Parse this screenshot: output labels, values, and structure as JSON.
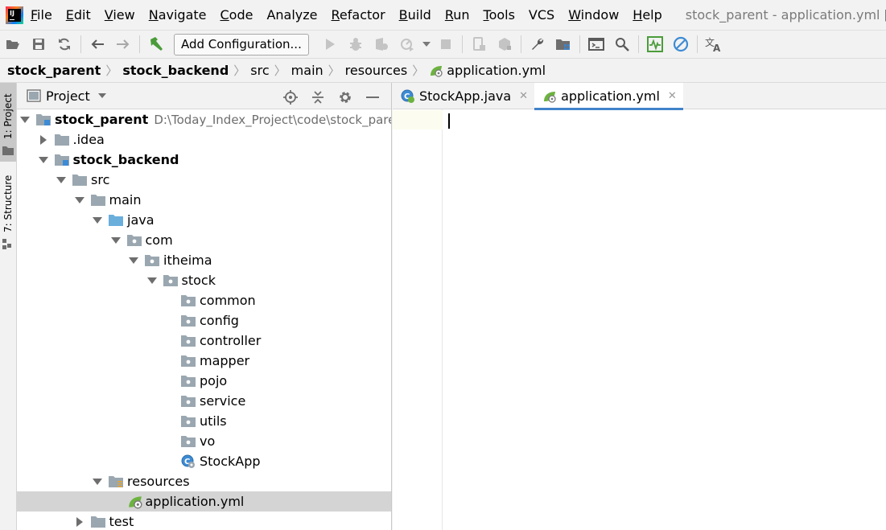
{
  "menu": {
    "items": [
      {
        "label": "File",
        "mnemonic": "F",
        "rest": "ile"
      },
      {
        "label": "Edit",
        "mnemonic": "E",
        "rest": "dit"
      },
      {
        "label": "View",
        "mnemonic": "V",
        "rest": "iew"
      },
      {
        "label": "Navigate",
        "mnemonic": "N",
        "rest": "avigate"
      },
      {
        "label": "Code",
        "mnemonic": "C",
        "rest": "ode"
      },
      {
        "label": "Analyze",
        "mnemonic": "",
        "rest": "Analyze"
      },
      {
        "label": "Refactor",
        "mnemonic": "R",
        "rest": "efactor"
      },
      {
        "label": "Build",
        "mnemonic": "B",
        "rest": "uild"
      },
      {
        "label": "Run",
        "mnemonic": "R",
        "rest": "un"
      },
      {
        "label": "Tools",
        "mnemonic": "T",
        "rest": "ools"
      },
      {
        "label": "VCS",
        "mnemonic": "",
        "rest": "VCS"
      },
      {
        "label": "Window",
        "mnemonic": "W",
        "rest": "indow"
      },
      {
        "label": "Help",
        "mnemonic": "H",
        "rest": "elp"
      }
    ],
    "window_title": "stock_parent - application.yml [stock_backend]"
  },
  "toolbar": {
    "config_label": "Add Configuration...",
    "icons": [
      "open-folder-icon",
      "save-icon",
      "sync-icon",
      "back-arrow-icon",
      "forward-arrow-icon",
      "build-hammer-icon",
      "run-icon",
      "debug-icon",
      "coverage-icon",
      "profile-icon",
      "dropdown-icon",
      "stop-icon",
      "device-icon",
      "deploy-icon",
      "wrench-icon",
      "project-structure-icon",
      "terminal-icon",
      "search-icon",
      "activity-monitor-icon",
      "disable-icon",
      "translate-icon"
    ]
  },
  "breadcrumb": {
    "items": [
      "stock_parent",
      "stock_backend",
      "src",
      "main",
      "resources",
      "application.yml"
    ]
  },
  "stripe": {
    "project_tab": "1: Project",
    "structure_tab": "7: Structure"
  },
  "project_panel": {
    "title": "Project",
    "tree": [
      {
        "label": "stock_parent",
        "path": "D:\\Today_Index_Project\\code\\stock_parent",
        "depth": 0,
        "arrow": "down",
        "icon": "module-folder-icon",
        "bold": true
      },
      {
        "label": ".idea",
        "depth": 1,
        "arrow": "right",
        "icon": "folder-icon"
      },
      {
        "label": "stock_backend",
        "depth": 1,
        "arrow": "down",
        "icon": "module-folder-icon",
        "bold": true
      },
      {
        "label": "src",
        "depth": 2,
        "arrow": "down",
        "icon": "folder-icon"
      },
      {
        "label": "main",
        "depth": 3,
        "arrow": "down",
        "icon": "folder-icon"
      },
      {
        "label": "java",
        "depth": 4,
        "arrow": "down",
        "icon": "source-folder-icon"
      },
      {
        "label": "com",
        "depth": 5,
        "arrow": "down",
        "icon": "package-icon"
      },
      {
        "label": "itheima",
        "depth": 6,
        "arrow": "down",
        "icon": "package-icon"
      },
      {
        "label": "stock",
        "depth": 7,
        "arrow": "down",
        "icon": "package-icon"
      },
      {
        "label": "common",
        "depth": 8,
        "arrow": "none",
        "icon": "package-icon"
      },
      {
        "label": "config",
        "depth": 8,
        "arrow": "none",
        "icon": "package-icon"
      },
      {
        "label": "controller",
        "depth": 8,
        "arrow": "none",
        "icon": "package-icon"
      },
      {
        "label": "mapper",
        "depth": 8,
        "arrow": "none",
        "icon": "package-icon"
      },
      {
        "label": "pojo",
        "depth": 8,
        "arrow": "none",
        "icon": "package-icon"
      },
      {
        "label": "service",
        "depth": 8,
        "arrow": "none",
        "icon": "package-icon"
      },
      {
        "label": "utils",
        "depth": 8,
        "arrow": "none",
        "icon": "package-icon"
      },
      {
        "label": "vo",
        "depth": 8,
        "arrow": "none",
        "icon": "package-icon"
      },
      {
        "label": "StockApp",
        "depth": 8,
        "arrow": "none",
        "icon": "spring-class-icon"
      },
      {
        "label": "resources",
        "depth": 4,
        "arrow": "down",
        "icon": "resources-folder-icon"
      },
      {
        "label": "application.yml",
        "depth": 5,
        "arrow": "none",
        "icon": "spring-yml-icon",
        "selected": true
      },
      {
        "label": "test",
        "depth": 3,
        "arrow": "right",
        "icon": "folder-icon"
      }
    ]
  },
  "editor": {
    "tabs": [
      {
        "label": "StockApp.java",
        "icon": "spring-class-icon",
        "active": false
      },
      {
        "label": "application.yml",
        "icon": "spring-yml-icon",
        "active": true
      }
    ]
  },
  "colors": {
    "background": "#f2f2f2",
    "selection": "#d4d4d4",
    "active_tab_underline": "#4083c9",
    "folder": "#9aa7b0",
    "source_folder": "#6aaedc",
    "spring_green": "#6db33f"
  }
}
